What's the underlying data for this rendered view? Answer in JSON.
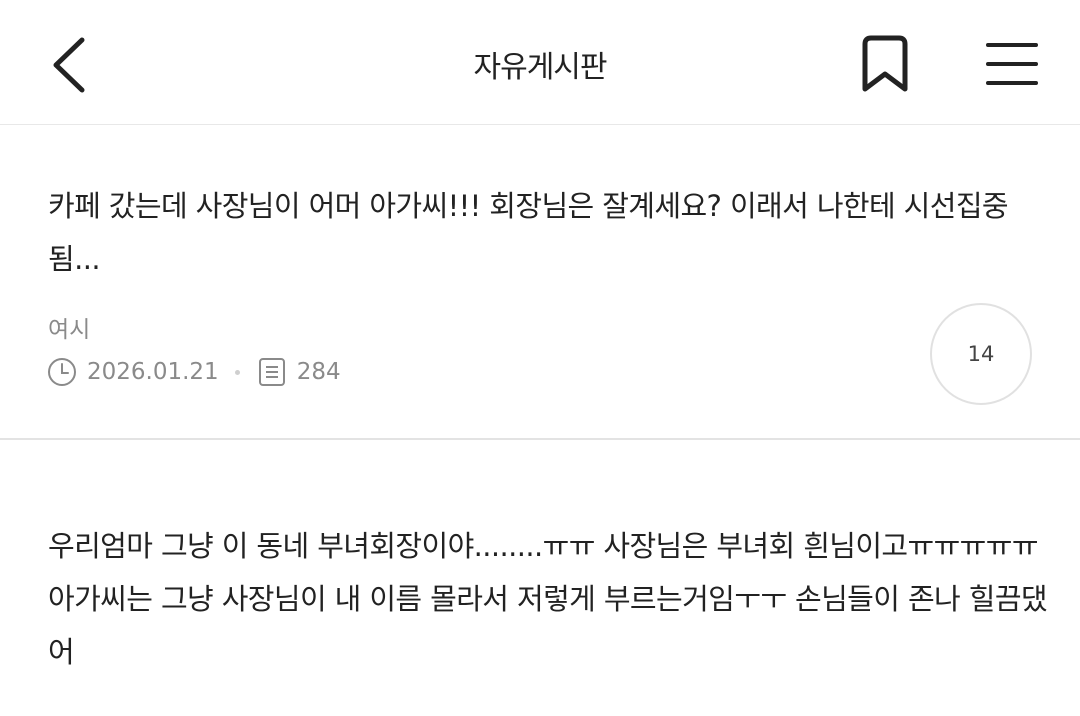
{
  "header": {
    "title": "자유게시판",
    "back_icon": "chevron-left-icon",
    "bookmark_icon": "bookmark-icon",
    "menu_icon": "hamburger-menu-icon"
  },
  "posts": [
    {
      "body": "카페 갔는데 사장님이 어머 아가씨!!! 회장님은 잘계세요? 이래서 나한테 시선집중 됨...",
      "author": "여시",
      "date": "2026.01.21",
      "views": "284",
      "comments": "14"
    },
    {
      "body": "우리엄마 그냥 이 동네 부녀회장이야........ㅠㅠ 사장님은 부녀회 흰님이고ㅠㅠㅠㅠㅠ 아가씨는 그냥 사장님이 내 이름 몰라서 저렇게 부르는거임ㅜㅜ 손님들이 존나 힐끔댔어"
    }
  ],
  "colors": {
    "text": "#222222",
    "meta": "#8a8a8a",
    "divider": "#e3e3e3"
  }
}
